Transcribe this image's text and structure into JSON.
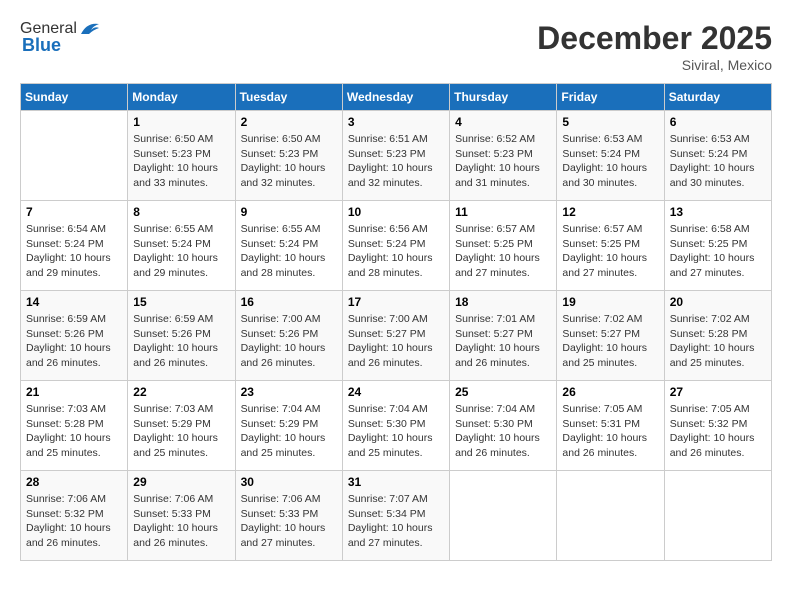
{
  "header": {
    "logo_general": "General",
    "logo_blue": "Blue",
    "month_title": "December 2025",
    "location": "Siviral, Mexico"
  },
  "days_of_week": [
    "Sunday",
    "Monday",
    "Tuesday",
    "Wednesday",
    "Thursday",
    "Friday",
    "Saturday"
  ],
  "weeks": [
    [
      {
        "day": "",
        "info": ""
      },
      {
        "day": "1",
        "info": "Sunrise: 6:50 AM\nSunset: 5:23 PM\nDaylight: 10 hours\nand 33 minutes."
      },
      {
        "day": "2",
        "info": "Sunrise: 6:50 AM\nSunset: 5:23 PM\nDaylight: 10 hours\nand 32 minutes."
      },
      {
        "day": "3",
        "info": "Sunrise: 6:51 AM\nSunset: 5:23 PM\nDaylight: 10 hours\nand 32 minutes."
      },
      {
        "day": "4",
        "info": "Sunrise: 6:52 AM\nSunset: 5:23 PM\nDaylight: 10 hours\nand 31 minutes."
      },
      {
        "day": "5",
        "info": "Sunrise: 6:53 AM\nSunset: 5:24 PM\nDaylight: 10 hours\nand 30 minutes."
      },
      {
        "day": "6",
        "info": "Sunrise: 6:53 AM\nSunset: 5:24 PM\nDaylight: 10 hours\nand 30 minutes."
      }
    ],
    [
      {
        "day": "7",
        "info": "Sunrise: 6:54 AM\nSunset: 5:24 PM\nDaylight: 10 hours\nand 29 minutes."
      },
      {
        "day": "8",
        "info": "Sunrise: 6:55 AM\nSunset: 5:24 PM\nDaylight: 10 hours\nand 29 minutes."
      },
      {
        "day": "9",
        "info": "Sunrise: 6:55 AM\nSunset: 5:24 PM\nDaylight: 10 hours\nand 28 minutes."
      },
      {
        "day": "10",
        "info": "Sunrise: 6:56 AM\nSunset: 5:24 PM\nDaylight: 10 hours\nand 28 minutes."
      },
      {
        "day": "11",
        "info": "Sunrise: 6:57 AM\nSunset: 5:25 PM\nDaylight: 10 hours\nand 27 minutes."
      },
      {
        "day": "12",
        "info": "Sunrise: 6:57 AM\nSunset: 5:25 PM\nDaylight: 10 hours\nand 27 minutes."
      },
      {
        "day": "13",
        "info": "Sunrise: 6:58 AM\nSunset: 5:25 PM\nDaylight: 10 hours\nand 27 minutes."
      }
    ],
    [
      {
        "day": "14",
        "info": "Sunrise: 6:59 AM\nSunset: 5:26 PM\nDaylight: 10 hours\nand 26 minutes."
      },
      {
        "day": "15",
        "info": "Sunrise: 6:59 AM\nSunset: 5:26 PM\nDaylight: 10 hours\nand 26 minutes."
      },
      {
        "day": "16",
        "info": "Sunrise: 7:00 AM\nSunset: 5:26 PM\nDaylight: 10 hours\nand 26 minutes."
      },
      {
        "day": "17",
        "info": "Sunrise: 7:00 AM\nSunset: 5:27 PM\nDaylight: 10 hours\nand 26 minutes."
      },
      {
        "day": "18",
        "info": "Sunrise: 7:01 AM\nSunset: 5:27 PM\nDaylight: 10 hours\nand 26 minutes."
      },
      {
        "day": "19",
        "info": "Sunrise: 7:02 AM\nSunset: 5:27 PM\nDaylight: 10 hours\nand 25 minutes."
      },
      {
        "day": "20",
        "info": "Sunrise: 7:02 AM\nSunset: 5:28 PM\nDaylight: 10 hours\nand 25 minutes."
      }
    ],
    [
      {
        "day": "21",
        "info": "Sunrise: 7:03 AM\nSunset: 5:28 PM\nDaylight: 10 hours\nand 25 minutes."
      },
      {
        "day": "22",
        "info": "Sunrise: 7:03 AM\nSunset: 5:29 PM\nDaylight: 10 hours\nand 25 minutes."
      },
      {
        "day": "23",
        "info": "Sunrise: 7:04 AM\nSunset: 5:29 PM\nDaylight: 10 hours\nand 25 minutes."
      },
      {
        "day": "24",
        "info": "Sunrise: 7:04 AM\nSunset: 5:30 PM\nDaylight: 10 hours\nand 25 minutes."
      },
      {
        "day": "25",
        "info": "Sunrise: 7:04 AM\nSunset: 5:30 PM\nDaylight: 10 hours\nand 26 minutes."
      },
      {
        "day": "26",
        "info": "Sunrise: 7:05 AM\nSunset: 5:31 PM\nDaylight: 10 hours\nand 26 minutes."
      },
      {
        "day": "27",
        "info": "Sunrise: 7:05 AM\nSunset: 5:32 PM\nDaylight: 10 hours\nand 26 minutes."
      }
    ],
    [
      {
        "day": "28",
        "info": "Sunrise: 7:06 AM\nSunset: 5:32 PM\nDaylight: 10 hours\nand 26 minutes."
      },
      {
        "day": "29",
        "info": "Sunrise: 7:06 AM\nSunset: 5:33 PM\nDaylight: 10 hours\nand 26 minutes."
      },
      {
        "day": "30",
        "info": "Sunrise: 7:06 AM\nSunset: 5:33 PM\nDaylight: 10 hours\nand 27 minutes."
      },
      {
        "day": "31",
        "info": "Sunrise: 7:07 AM\nSunset: 5:34 PM\nDaylight: 10 hours\nand 27 minutes."
      },
      {
        "day": "",
        "info": ""
      },
      {
        "day": "",
        "info": ""
      },
      {
        "day": "",
        "info": ""
      }
    ]
  ]
}
